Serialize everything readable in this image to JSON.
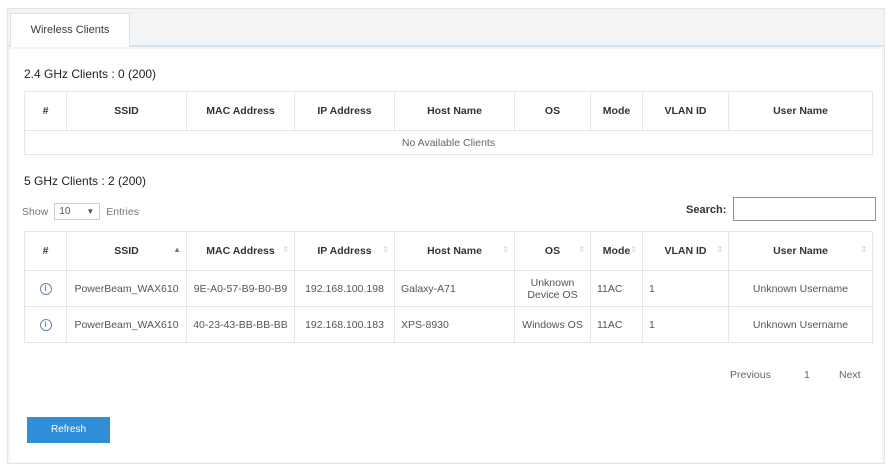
{
  "tabs": [
    {
      "label": "Wireless Clients"
    }
  ],
  "clients24": {
    "title": "2.4 GHz Clients : 0 (200)",
    "columns": [
      "#",
      "SSID",
      "MAC Address",
      "IP Address",
      "Host Name",
      "OS",
      "Mode",
      "VLAN ID",
      "User Name"
    ],
    "empty_message": "No Available Clients"
  },
  "clients5": {
    "title": "5 GHz Clients : 2 (200)",
    "show_label": "Show",
    "entries_value": "10",
    "entries_label": "Entries",
    "search_label": "Search:",
    "search_value": "",
    "columns": [
      "#",
      "SSID",
      "MAC Address",
      "IP Address",
      "Host Name",
      "OS",
      "Mode",
      "VLAN ID",
      "User Name"
    ],
    "rows": [
      {
        "ssid": "PowerBeam_WAX610",
        "mac": "9E-A0-57-B9-B0-B9",
        "ip": "192.168.100.198",
        "host": "Galaxy-A71",
        "os": "Unknown Device OS",
        "mode": "11AC",
        "vlan": "1",
        "user": "Unknown Username"
      },
      {
        "ssid": "PowerBeam_WAX610",
        "mac": "40-23-43-BB-BB-BB",
        "ip": "192.168.100.183",
        "host": "XPS-8930",
        "os": "Windows OS",
        "mode": "11AC",
        "vlan": "1",
        "user": "Unknown Username"
      }
    ],
    "pagination": {
      "previous": "Previous",
      "page": "1",
      "next": "Next"
    }
  },
  "refresh_label": "Refresh",
  "icons": {
    "row_info": "info-circle-icon",
    "sort": "sort-arrows-icon",
    "select": "chevron-down-icon"
  },
  "colors": {
    "accent": "#2e8fd8",
    "tab_underline": "#d6e4f0",
    "info_icon": "#6c86b8"
  }
}
